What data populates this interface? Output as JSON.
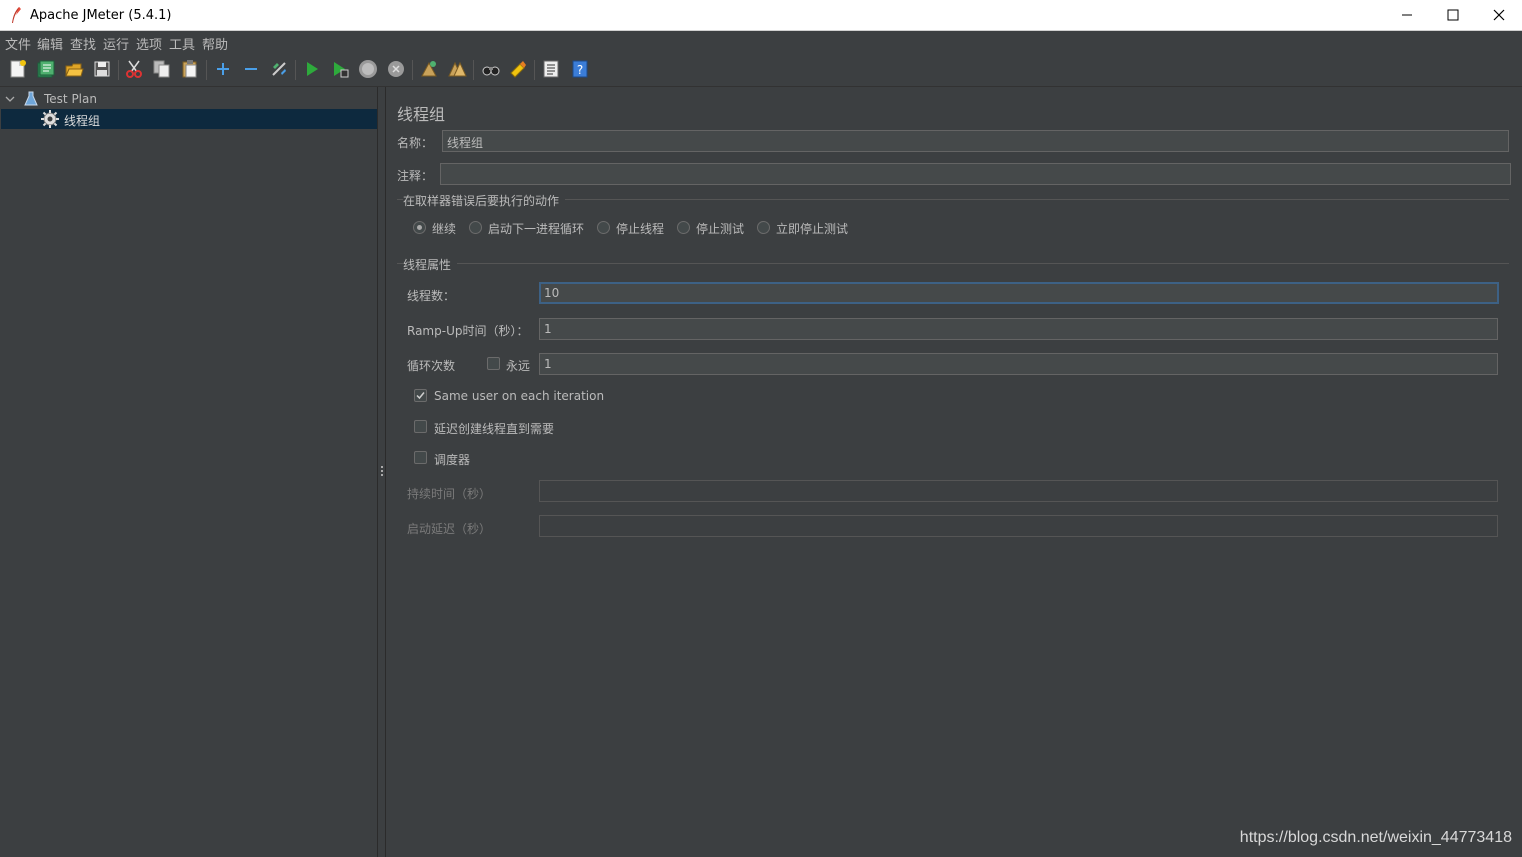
{
  "window": {
    "title": "Apache JMeter (5.4.1)"
  },
  "menu": [
    "文件",
    "编辑",
    "查找",
    "运行",
    "选项",
    "工具",
    "帮助"
  ],
  "toolbar_icons": [
    "new-icon",
    "templates-icon",
    "open-icon",
    "save-icon",
    "cut-icon",
    "copy-icon",
    "paste-icon",
    "expand-icon",
    "collapse-icon",
    "toggle-icon",
    "start-icon",
    "start-no-pause-icon",
    "stop-icon",
    "shutdown-icon",
    "clear-icon",
    "clear-all-icon",
    "search-icon",
    "reset-search-icon",
    "function-helper-icon",
    "help-icon"
  ],
  "tree": {
    "root": "Test Plan",
    "child": "线程组"
  },
  "panel": {
    "title": "线程组",
    "name_label": "名称：",
    "name_value": "线程组",
    "comment_label": "注释：",
    "comment_value": "",
    "on_error": {
      "title": "在取样器错误后要执行的动作",
      "options": [
        "继续",
        "启动下一进程循环",
        "停止线程",
        "停止测试",
        "立即停止测试"
      ],
      "selected": "继续"
    },
    "thread_props": {
      "title": "线程属性",
      "threads_label": "线程数：",
      "threads_value": "10",
      "rampup_label": "Ramp-Up时间（秒）：",
      "rampup_value": "1",
      "loop_label": "循环次数",
      "forever_label": "永远",
      "forever_checked": false,
      "loop_value": "1",
      "same_user_label": "Same user on each iteration",
      "same_user_checked": true,
      "delay_label": "延迟创建线程直到需要",
      "delay_checked": false,
      "scheduler_label": "调度器",
      "scheduler_checked": false,
      "duration_label": "持续时间（秒）",
      "duration_value": "",
      "startup_delay_label": "启动延迟（秒）",
      "startup_delay_value": ""
    }
  },
  "watermark": "https://blog.csdn.net/weixin_44773418"
}
